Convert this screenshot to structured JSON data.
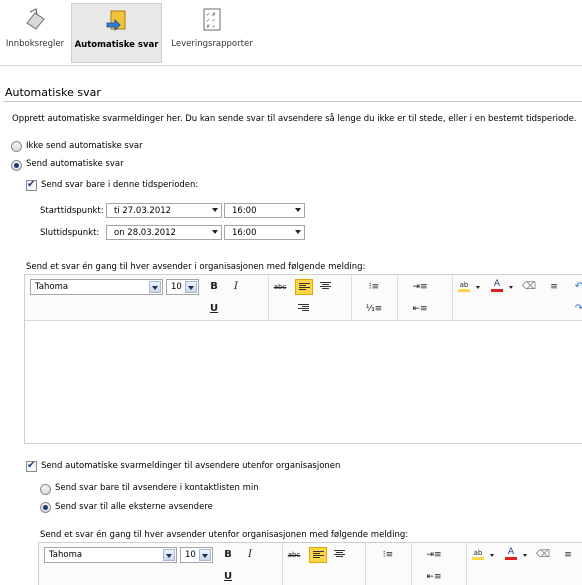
{
  "ribbon": {
    "tabs": [
      {
        "label": "Innboksregler",
        "active": false
      },
      {
        "label": "Automatiske svar",
        "active": true
      },
      {
        "label": "Leveringsrapporter",
        "active": false
      }
    ]
  },
  "section": {
    "title": "Automatiske svar"
  },
  "intro": "Opprett automatiske svarmeldinger her. Du kan sende svar til avsendere så lenge du ikke er til stede, eller i en bestemt tidsperiode.",
  "options": {
    "no_reply": {
      "label": "Ikke send automatiske svar",
      "selected": false
    },
    "send_reply": {
      "label": "Send automatiske svar",
      "selected": true
    },
    "time_period": {
      "label": "Send svar bare i denne tidsperioden:",
      "checked": true
    }
  },
  "start": {
    "label": "Starttidspunkt:",
    "date": "ti 27.03.2012",
    "time": "16:00"
  },
  "end": {
    "label": "Sluttidspunkt:",
    "date": "on 28.03.2012",
    "time": "16:00"
  },
  "internal_msg_label": "Send et svar én gang til hver avsender i organisasjonen med følgende melding:",
  "editor1": {
    "font": "Tahoma",
    "size": "10"
  },
  "external": {
    "label": "Send automatiske svarmeldinger til avsendere utenfor organisasjonen",
    "checked": true,
    "contacts_only": {
      "label": "Send svar bare til avsendere i kontaktlisten min",
      "selected": false
    },
    "all_external": {
      "label": "Send svar til alle eksterne avsendere",
      "selected": true
    }
  },
  "external_msg_label": "Send et svar én gang til hver avsender utenfor organisasjonen med følgende melding:",
  "editor2": {
    "font": "Tahoma",
    "size": "10"
  },
  "toolbar_glyphs": {
    "bold": "B",
    "italic": "I",
    "underline": "U",
    "strike": "abc",
    "font_color": "A"
  },
  "colors": {
    "highlight": "#ffd54a",
    "font_color_bar": "#e02020",
    "accent": "#24407a"
  }
}
